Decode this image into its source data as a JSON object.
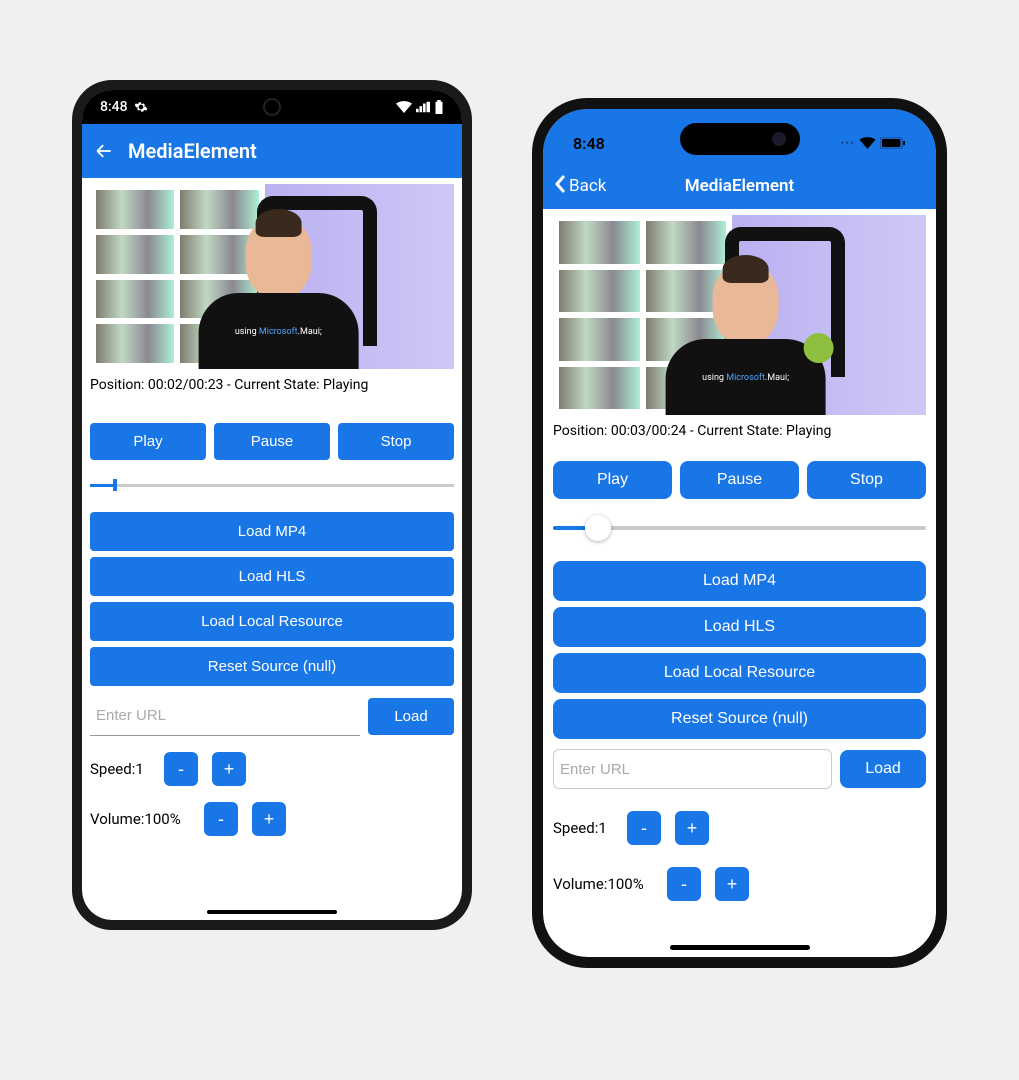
{
  "android": {
    "status_time": "8:48",
    "appbar_title": "MediaElement",
    "position_line": "Position: 00:02/00:23 - Current State: Playing",
    "tshirt": {
      "prefix": "using ",
      "mid": "Microsoft",
      "suffix": ".Maui;"
    },
    "buttons": {
      "play": "Play",
      "pause": "Pause",
      "stop": "Stop"
    },
    "stack": {
      "mp4": "Load MP4",
      "hls": "Load HLS",
      "local": "Load Local Resource",
      "reset": "Reset Source (null)"
    },
    "url_placeholder": "Enter URL",
    "load": "Load",
    "speed_label": "Speed:",
    "speed_value": "1",
    "volume_label": "Volume:",
    "volume_value": "100%",
    "minus": "-",
    "plus": "+"
  },
  "ios": {
    "status_time": "8:48",
    "back_label": "Back",
    "appbar_title": "MediaElement",
    "position_line": "Position: 00:03/00:24 - Current State: Playing",
    "tshirt": {
      "prefix": "using ",
      "mid": "Microsoft",
      "suffix": ".Maui;"
    },
    "buttons": {
      "play": "Play",
      "pause": "Pause",
      "stop": "Stop"
    },
    "stack": {
      "mp4": "Load MP4",
      "hls": "Load HLS",
      "local": "Load Local Resource",
      "reset": "Reset Source (null)"
    },
    "url_placeholder": "Enter URL",
    "load": "Load",
    "speed_label": "Speed:",
    "speed_value": "1",
    "volume_label": "Volume:",
    "volume_value": "100%",
    "minus": "-",
    "plus": "+"
  }
}
